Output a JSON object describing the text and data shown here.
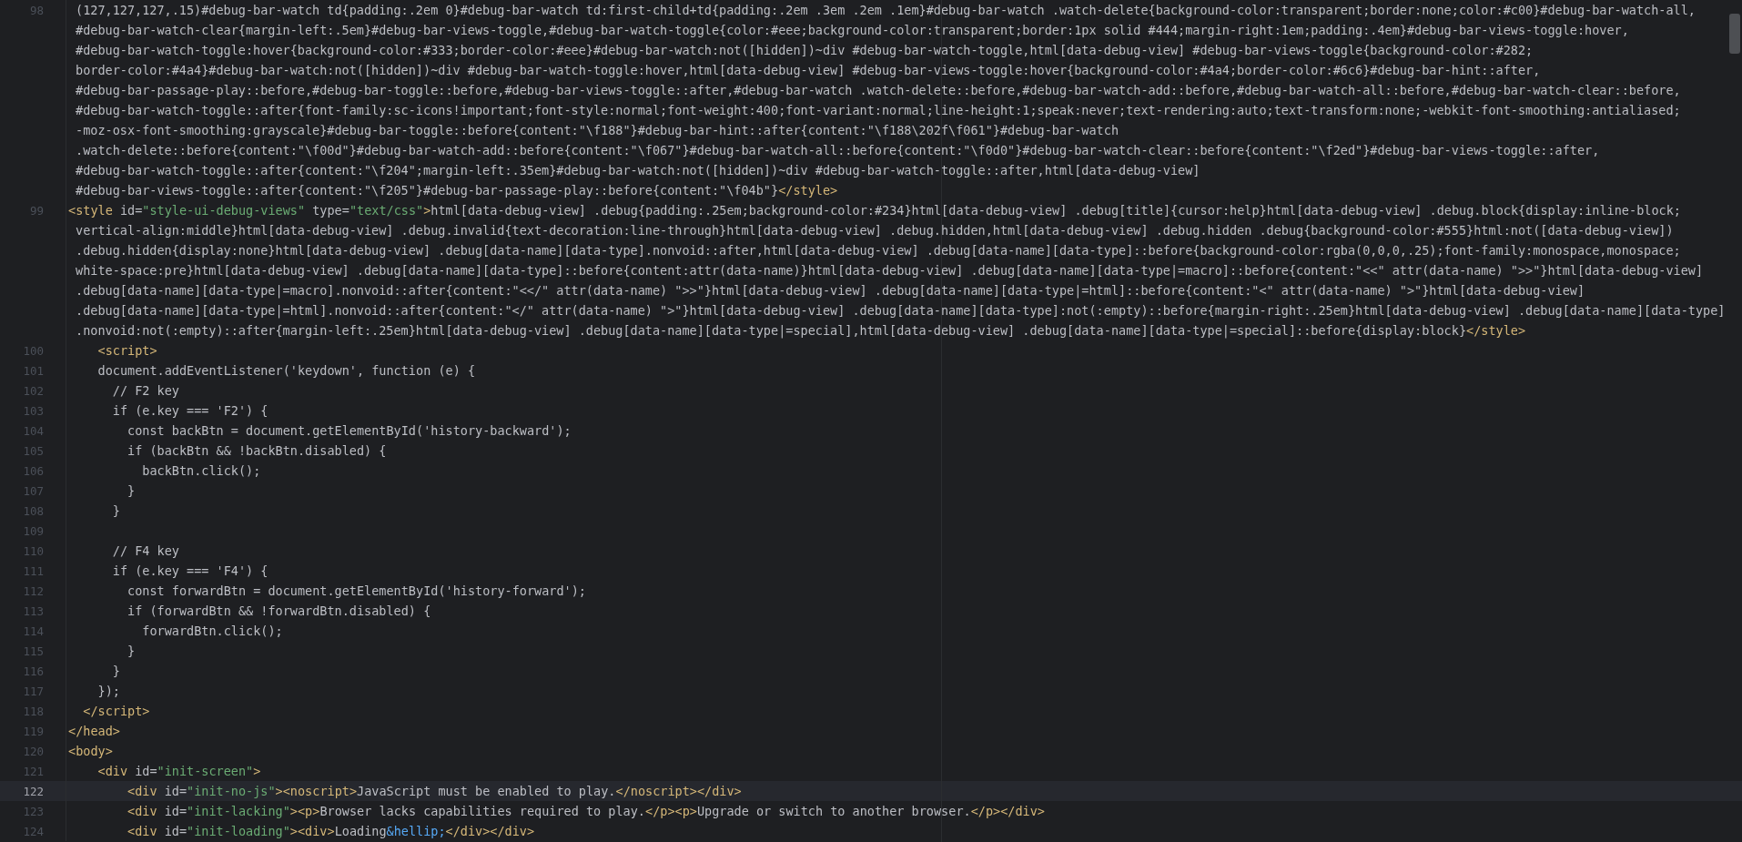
{
  "editor": {
    "lines": [
      {
        "number": "98",
        "current": false,
        "rows": [
          {
            "wrapped": true,
            "segments": [
              {
                "kind": "text",
                "text": "(127,127,127,.15)#debug-bar-watch td{padding:.2em 0}#debug-bar-watch td:first-child+td{padding:.2em .3em .2em .1em}#debug-bar-watch .watch-delete{background-color:transparent;border:none;color:#c00}#debug-bar-watch-all,"
              }
            ]
          },
          {
            "wrapped": true,
            "segments": [
              {
                "kind": "text",
                "text": "#debug-bar-watch-clear{margin-left:.5em}#debug-bar-views-toggle,#debug-bar-watch-toggle{color:#eee;background-color:transparent;border:1px solid #444;margin-right:1em;padding:.4em}#debug-bar-views-toggle:hover,"
              }
            ]
          },
          {
            "wrapped": true,
            "segments": [
              {
                "kind": "text",
                "text": "#debug-bar-watch-toggle:hover{background-color:#333;border-color:#eee}#debug-bar-watch:not([hidden])~div #debug-bar-watch-toggle,html[data-debug-view] #debug-bar-views-toggle{background-color:#282;"
              }
            ]
          },
          {
            "wrapped": true,
            "segments": [
              {
                "kind": "text",
                "text": "border-color:#4a4}#debug-bar-watch:not([hidden])~div #debug-bar-watch-toggle:hover,html[data-debug-view] #debug-bar-views-toggle:hover{background-color:#4a4;border-color:#6c6}#debug-bar-hint::after,"
              }
            ]
          },
          {
            "wrapped": true,
            "segments": [
              {
                "kind": "text",
                "text": "#debug-bar-passage-play::before,#debug-bar-toggle::before,#debug-bar-views-toggle::after,#debug-bar-watch .watch-delete::before,#debug-bar-watch-add::before,#debug-bar-watch-all::before,#debug-bar-watch-clear::before,"
              }
            ]
          },
          {
            "wrapped": true,
            "segments": [
              {
                "kind": "text",
                "text": "#debug-bar-watch-toggle::after{font-family:sc-icons!important;font-style:normal;font-weight:400;font-variant:normal;line-height:1;speak:never;text-rendering:auto;text-transform:none;-webkit-font-smoothing:antialiased;"
              }
            ]
          },
          {
            "wrapped": true,
            "segments": [
              {
                "kind": "text",
                "text": "-moz-osx-font-smoothing:grayscale}#debug-bar-toggle::before{content:\"\\f188\"}#debug-bar-hint::after{content:\"\\f188\\202f\\f061\"}#debug-bar-watch"
              }
            ]
          },
          {
            "wrapped": true,
            "segments": [
              {
                "kind": "text",
                "text": ".watch-delete::before{content:\"\\f00d\"}#debug-bar-watch-add::before{content:\"\\f067\"}#debug-bar-watch-all::before{content:\"\\f0d0\"}#debug-bar-watch-clear::before{content:\"\\f2ed\"}#debug-bar-views-toggle::after,"
              }
            ]
          },
          {
            "wrapped": true,
            "segments": [
              {
                "kind": "text",
                "text": "#debug-bar-watch-toggle::after{content:\"\\f204\";margin-left:.35em}#debug-bar-watch:not([hidden])~div #debug-bar-watch-toggle::after,html[data-debug-view]"
              }
            ]
          },
          {
            "wrapped": true,
            "segments": [
              {
                "kind": "text",
                "text": "#debug-bar-views-toggle::after{content:\"\\f205\"}#debug-bar-passage-play::before{content:\"\\f04b\"}"
              },
              {
                "kind": "tag",
                "text": "</style>"
              }
            ]
          }
        ]
      },
      {
        "number": "99",
        "current": false,
        "rows": [
          {
            "wrapped": false,
            "segments": [
              {
                "kind": "tag",
                "text": "<style"
              },
              {
                "kind": "text",
                "text": " id="
              },
              {
                "kind": "string",
                "text": "\"style-ui-debug-views\""
              },
              {
                "kind": "text",
                "text": " type="
              },
              {
                "kind": "string",
                "text": "\"text/css\""
              },
              {
                "kind": "tag",
                "text": ">"
              },
              {
                "kind": "text",
                "text": "html[data-debug-view] .debug{padding:.25em;background-color:#234}html[data-debug-view] .debug[title]{cursor:help}html[data-debug-view] .debug.block{display:inline-block;"
              }
            ]
          },
          {
            "wrapped": true,
            "segments": [
              {
                "kind": "text",
                "text": "vertical-align:middle}html[data-debug-view] .debug.invalid{text-decoration:line-through}html[data-debug-view] .debug.hidden,html[data-debug-view] .debug.hidden .debug{background-color:#555}html:not([data-debug-view])"
              }
            ]
          },
          {
            "wrapped": true,
            "segments": [
              {
                "kind": "text",
                "text": ".debug.hidden{display:none}html[data-debug-view] .debug[data-name][data-type].nonvoid::after,html[data-debug-view] .debug[data-name][data-type]::before{background-color:rgba(0,0,0,.25);font-family:monospace,monospace;"
              }
            ]
          },
          {
            "wrapped": true,
            "segments": [
              {
                "kind": "text",
                "text": "white-space:pre}html[data-debug-view] .debug[data-name][data-type]::before{content:attr(data-name)}html[data-debug-view] .debug[data-name][data-type|=macro]::before{content:\"<<\" attr(data-name) \">>\"}html[data-debug-view]"
              }
            ]
          },
          {
            "wrapped": true,
            "segments": [
              {
                "kind": "text",
                "text": ".debug[data-name][data-type|=macro].nonvoid::after{content:\"<</\" attr(data-name) \">>\"}html[data-debug-view] .debug[data-name][data-type|=html]::before{content:\"<\" attr(data-name) \">\"}html[data-debug-view]"
              }
            ]
          },
          {
            "wrapped": true,
            "segments": [
              {
                "kind": "text",
                "text": ".debug[data-name][data-type|=html].nonvoid::after{content:\"</\" attr(data-name) \">\"}html[data-debug-view] .debug[data-name][data-type]:not(:empty)::before{margin-right:.25em}html[data-debug-view] .debug[data-name][data-type]"
              }
            ]
          },
          {
            "wrapped": true,
            "segments": [
              {
                "kind": "text",
                "text": ".nonvoid:not(:empty)::after{margin-left:.25em}html[data-debug-view] .debug[data-name][data-type|=special],html[data-debug-view] .debug[data-name][data-type|=special]::before{display:block}"
              },
              {
                "kind": "tag",
                "text": "</style>"
              }
            ]
          }
        ]
      },
      {
        "number": "100",
        "current": false,
        "rows": [
          {
            "wrapped": false,
            "segments": [
              {
                "kind": "tag",
                "text": "    <script>"
              }
            ]
          }
        ]
      },
      {
        "number": "101",
        "current": false,
        "rows": [
          {
            "wrapped": false,
            "segments": [
              {
                "kind": "text",
                "text": "    document.addEventListener('keydown', function (e) {"
              }
            ]
          }
        ]
      },
      {
        "number": "102",
        "current": false,
        "rows": [
          {
            "wrapped": false,
            "segments": [
              {
                "kind": "text",
                "text": "      // F2 key"
              }
            ]
          }
        ]
      },
      {
        "number": "103",
        "current": false,
        "rows": [
          {
            "wrapped": false,
            "segments": [
              {
                "kind": "text",
                "text": "      if (e.key === 'F2') {"
              }
            ]
          }
        ]
      },
      {
        "number": "104",
        "current": false,
        "rows": [
          {
            "wrapped": false,
            "segments": [
              {
                "kind": "text",
                "text": "        const backBtn = document.getElementById('history-backward');"
              }
            ]
          }
        ]
      },
      {
        "number": "105",
        "current": false,
        "rows": [
          {
            "wrapped": false,
            "segments": [
              {
                "kind": "text",
                "text": "        if (backBtn && !backBtn.disabled) {"
              }
            ]
          }
        ]
      },
      {
        "number": "106",
        "current": false,
        "rows": [
          {
            "wrapped": false,
            "segments": [
              {
                "kind": "text",
                "text": "          backBtn.click();"
              }
            ]
          }
        ]
      },
      {
        "number": "107",
        "current": false,
        "rows": [
          {
            "wrapped": false,
            "segments": [
              {
                "kind": "text",
                "text": "        }"
              }
            ]
          }
        ]
      },
      {
        "number": "108",
        "current": false,
        "rows": [
          {
            "wrapped": false,
            "segments": [
              {
                "kind": "text",
                "text": "      }"
              }
            ]
          }
        ]
      },
      {
        "number": "109",
        "current": false
      },
      {
        "number": "110",
        "current": false,
        "rows": [
          {
            "wrapped": false,
            "segments": [
              {
                "kind": "text",
                "text": "      // F4 key"
              }
            ]
          }
        ]
      },
      {
        "number": "111",
        "current": false,
        "rows": [
          {
            "wrapped": false,
            "segments": [
              {
                "kind": "text",
                "text": "      if (e.key === 'F4') {"
              }
            ]
          }
        ]
      },
      {
        "number": "112",
        "current": false,
        "rows": [
          {
            "wrapped": false,
            "segments": [
              {
                "kind": "text",
                "text": "        const forwardBtn = document.getElementById('history-forward');"
              }
            ]
          }
        ]
      },
      {
        "number": "113",
        "current": false,
        "rows": [
          {
            "wrapped": false,
            "segments": [
              {
                "kind": "text",
                "text": "        if (forwardBtn && !forwardBtn.disabled) {"
              }
            ]
          }
        ]
      },
      {
        "number": "114",
        "current": false,
        "rows": [
          {
            "wrapped": false,
            "segments": [
              {
                "kind": "text",
                "text": "          forwardBtn.click();"
              }
            ]
          }
        ]
      },
      {
        "number": "115",
        "current": false,
        "rows": [
          {
            "wrapped": false,
            "segments": [
              {
                "kind": "text",
                "text": "        }"
              }
            ]
          }
        ]
      },
      {
        "number": "116",
        "current": false,
        "rows": [
          {
            "wrapped": false,
            "segments": [
              {
                "kind": "text",
                "text": "      }"
              }
            ]
          }
        ]
      },
      {
        "number": "117",
        "current": false,
        "rows": [
          {
            "wrapped": false,
            "segments": [
              {
                "kind": "text",
                "text": "    });"
              }
            ]
          }
        ]
      },
      {
        "number": "118",
        "current": false,
        "rows": [
          {
            "wrapped": false,
            "segments": [
              {
                "kind": "tag",
                "text": "  </script>"
              }
            ]
          }
        ]
      },
      {
        "number": "119",
        "current": false,
        "rows": [
          {
            "wrapped": false,
            "segments": [
              {
                "kind": "tag",
                "text": "</head>"
              }
            ]
          }
        ]
      },
      {
        "number": "120",
        "current": false,
        "rows": [
          {
            "wrapped": false,
            "segments": [
              {
                "kind": "tag",
                "text": "<body>"
              }
            ]
          }
        ]
      },
      {
        "number": "121",
        "current": false,
        "rows": [
          {
            "wrapped": false,
            "segments": [
              {
                "kind": "tag",
                "text": "    <div"
              },
              {
                "kind": "text",
                "text": " id="
              },
              {
                "kind": "string",
                "text": "\"init-screen\""
              },
              {
                "kind": "tag",
                "text": ">"
              }
            ]
          }
        ]
      },
      {
        "number": "122",
        "current": true,
        "rows": [
          {
            "wrapped": false,
            "segments": [
              {
                "kind": "tag",
                "text": "        <div"
              },
              {
                "kind": "text",
                "text": " id="
              },
              {
                "kind": "string",
                "text": "\"init-no-js\""
              },
              {
                "kind": "tag",
                "text": "><noscript>"
              },
              {
                "kind": "text",
                "text": "JavaScript must be enabled to play."
              },
              {
                "kind": "tag",
                "text": "</noscript></div>"
              }
            ]
          }
        ]
      },
      {
        "number": "123",
        "current": false,
        "rows": [
          {
            "wrapped": false,
            "segments": [
              {
                "kind": "tag",
                "text": "        <div"
              },
              {
                "kind": "text",
                "text": " id="
              },
              {
                "kind": "string",
                "text": "\"init-lacking\""
              },
              {
                "kind": "tag",
                "text": "><p>"
              },
              {
                "kind": "text",
                "text": "Browser lacks capabilities required to play."
              },
              {
                "kind": "tag",
                "text": "</p><p>"
              },
              {
                "kind": "text",
                "text": "Upgrade or switch to another browser."
              },
              {
                "kind": "tag",
                "text": "</p></div>"
              }
            ]
          }
        ]
      },
      {
        "number": "124",
        "current": false,
        "rows": [
          {
            "wrapped": false,
            "segments": [
              {
                "kind": "tag",
                "text": "        <div"
              },
              {
                "kind": "text",
                "text": " id="
              },
              {
                "kind": "string",
                "text": "\"init-loading\""
              },
              {
                "kind": "tag",
                "text": "><div>"
              },
              {
                "kind": "text",
                "text": "Loading"
              },
              {
                "kind": "entity",
                "text": "&hellip;"
              },
              {
                "kind": "tag",
                "text": "</div></div>"
              }
            ]
          }
        ]
      }
    ]
  }
}
